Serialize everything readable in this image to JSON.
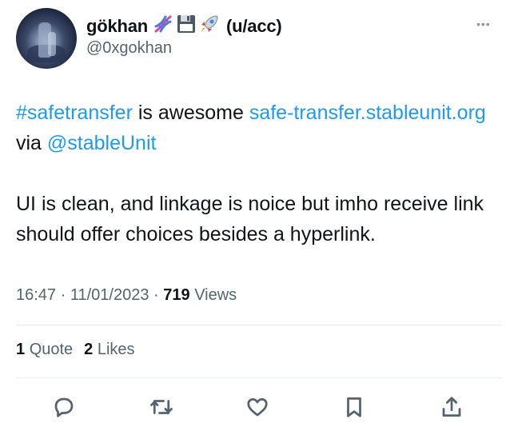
{
  "author": {
    "display_name": "gökhan",
    "emoji_icons": [
      "dna-icon",
      "floppy-disk-icon",
      "rocket-icon"
    ],
    "name_suffix": "(u/acc)",
    "handle": "@0xgokhan"
  },
  "tweet": {
    "hashtag": "#safetransfer",
    "text_1": " is awesome ",
    "link_text": "safe-transfer.stableunit.org",
    "text_2": " via ",
    "mention": "@stableUnit",
    "paragraph_2": "UI is clean, and linkage is noice but imho receive link should offer choices besides a hyperlink."
  },
  "meta": {
    "time": "16:47",
    "separator": " · ",
    "date": "11/01/2023",
    "views_count": "719",
    "views_label": "Views"
  },
  "stats": {
    "quotes_count": "1",
    "quotes_label": "Quote",
    "likes_count": "2",
    "likes_label": "Likes"
  },
  "actions": [
    "reply-icon",
    "retweet-icon",
    "like-icon",
    "bookmark-icon",
    "share-icon"
  ],
  "colors": {
    "link": "#1d9bf0",
    "secondary_text": "#536471",
    "primary_text": "#0f1419",
    "divider": "#e6ecf0"
  }
}
